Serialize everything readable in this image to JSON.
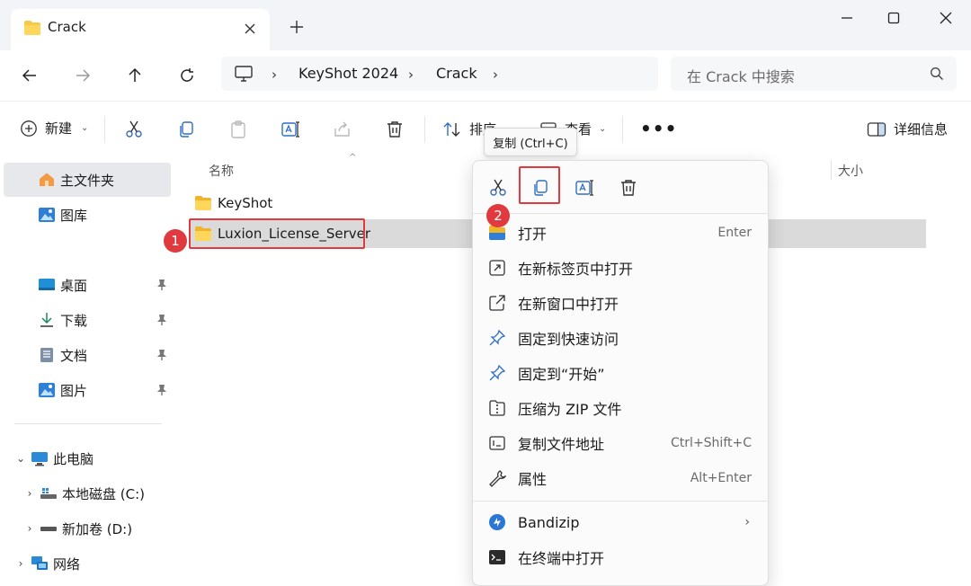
{
  "window": {
    "tab_title": "Crack",
    "tab_close": "✕",
    "new_tab": "+",
    "min": "—",
    "max": "▢",
    "close": "✕"
  },
  "nav": {
    "breadcrumb": [
      "KeyShot 2024",
      "Crack"
    ],
    "sep": "›",
    "search_placeholder": "在 Crack 中搜索"
  },
  "toolbar": {
    "new_label": "新建",
    "dropdown_arrow": "⌄",
    "sort_label": "排序",
    "view_label": "查看",
    "more_label": "•••",
    "details_label": "详细信息"
  },
  "sidebar": {
    "home": "主文件夹",
    "gallery": "图库",
    "quick": [
      {
        "label": "桌面"
      },
      {
        "label": "下载"
      },
      {
        "label": "文档"
      },
      {
        "label": "图片"
      }
    ],
    "tree": {
      "pc": "此电脑",
      "c_drive": "本地磁盘 (C:)",
      "d_drive": "新加卷 (D:)",
      "network": "网络",
      "expanded": "⌄",
      "collapsed": "›"
    }
  },
  "filelist": {
    "col_name": "名称",
    "col_size": "大小",
    "sort_caret": "^",
    "items": [
      {
        "name": "KeyShot"
      },
      {
        "name": "Luxion_License_Server"
      }
    ]
  },
  "annotations": {
    "badge_1": "1",
    "badge_2": "2"
  },
  "tooltip": "复制 (Ctrl+C)",
  "context_menu": {
    "items": [
      {
        "label": "打开",
        "shortcut": "Enter"
      },
      {
        "label": "在新标签页中打开",
        "shortcut": ""
      },
      {
        "label": "在新窗口中打开",
        "shortcut": ""
      },
      {
        "label": "固定到快速访问",
        "shortcut": ""
      },
      {
        "label": "固定到“开始”",
        "shortcut": ""
      },
      {
        "label": "压缩为 ZIP 文件",
        "shortcut": ""
      },
      {
        "label": "复制文件地址",
        "shortcut": "Ctrl+Shift+C"
      },
      {
        "label": "属性",
        "shortcut": "Alt+Enter"
      }
    ],
    "bandizip": "Bandizip",
    "bandizip_chevron": "›",
    "terminal": "在终端中打开"
  },
  "colors": {
    "accent": "#0067c0",
    "folder": "#f7c948",
    "highlight_red": "#e0393e",
    "selection": "#dadada"
  }
}
